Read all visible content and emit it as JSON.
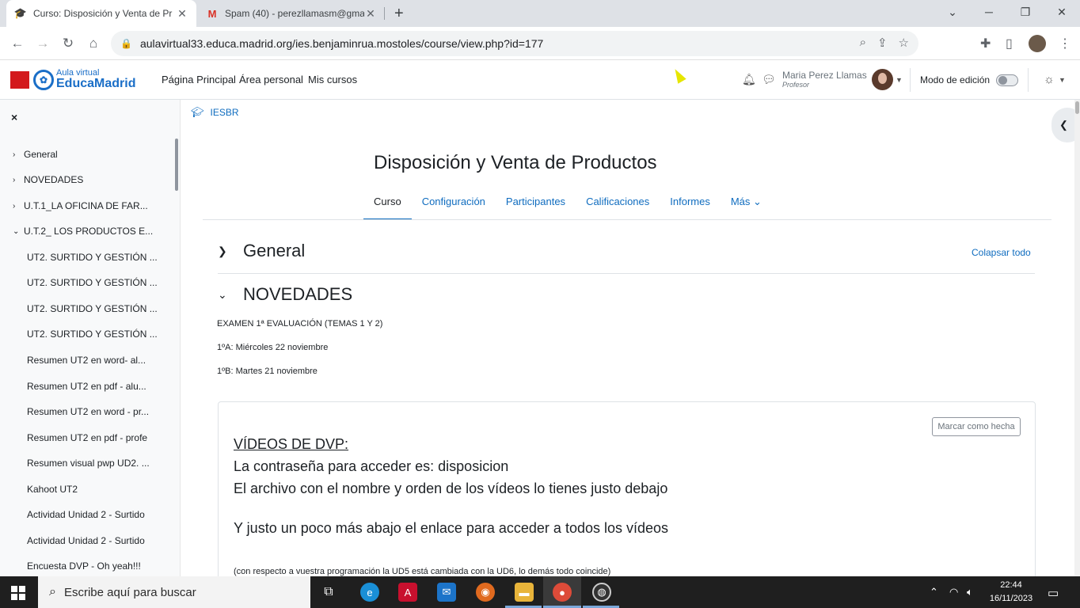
{
  "browser": {
    "tabs": [
      {
        "title": "Curso: Disposición y Venta de Pr",
        "close": "✕"
      },
      {
        "title": "Spam (40) - perezllamasm@gmail",
        "close": "✕"
      }
    ],
    "new_tab": "+",
    "url": "aulavirtual33.educa.madrid.org/ies.benjaminrua.mostoles/course/view.php?id=177"
  },
  "header": {
    "logo_top": "Aula virtual",
    "logo_bottom": "EducaMadrid",
    "nav": [
      "Página Principal",
      "Área personal",
      "Mis cursos"
    ],
    "user_name": "Maria Perez Llamas",
    "user_role": "Profesor",
    "edit_mode_label": "Modo de edición"
  },
  "drawer": {
    "close": "×",
    "items": [
      {
        "label": "General",
        "caret": "›"
      },
      {
        "label": "NOVEDADES",
        "caret": "›"
      },
      {
        "label": "U.T.1_LA OFICINA DE FAR...",
        "caret": "›"
      },
      {
        "label": "U.T.2_ LOS PRODUCTOS E...",
        "caret": "⌄"
      },
      {
        "label": "UT2. SURTIDO Y GESTIÓN ..."
      },
      {
        "label": "UT2. SURTIDO Y GESTIÓN ..."
      },
      {
        "label": "UT2. SURTIDO Y GESTIÓN ..."
      },
      {
        "label": "UT2. SURTIDO Y GESTIÓN ..."
      },
      {
        "label": "Resumen UT2 en word- al..."
      },
      {
        "label": "Resumen UT2 en pdf - alu..."
      },
      {
        "label": "Resumen UT2 en word - pr..."
      },
      {
        "label": "Resumen UT2 en pdf - profe"
      },
      {
        "label": "Resumen visual pwp UD2. ..."
      },
      {
        "label": "Kahoot UT2"
      },
      {
        "label": "Actividad Unidad 2 - Surtido"
      },
      {
        "label": "Actividad Unidad 2 - Surtido"
      },
      {
        "label": "Encuesta DVP - Oh yeah!!!"
      }
    ]
  },
  "main": {
    "breadcrumb": "IESBR",
    "course_title": "Disposición y Venta de Productos",
    "tabs": [
      "Curso",
      "Configuración",
      "Participantes",
      "Calificaciones",
      "Informes",
      "Más ⌄"
    ],
    "sections": {
      "general": "General",
      "novedades": "NOVEDADES",
      "collapse_all": "Colapsar todo"
    },
    "exam": {
      "title": "EXAMEN 1ª EVALUACIÓN (TEMAS 1 Y 2)",
      "a": "1ºA: Miércoles 22 noviembre",
      "b": "1ºB: Martes 21 noviembre"
    },
    "card": {
      "mark_done": "Marcar como hecha",
      "heading": "VÍDEOS DE DVP:",
      "line1": "La contraseña para acceder es: disposicion",
      "line2": "El archivo con el nombre y orden de los vídeos lo tienes justo debajo",
      "line3": "Y justo un poco más abajo el enlace para acceder a todos los vídeos",
      "note": "(con respecto a vuestra programación la UD5 está cambiada con la UD6, lo demás todo coincide)"
    }
  },
  "taskbar": {
    "search_placeholder": "Escribe aquí para buscar",
    "time": "22:44",
    "date": "16/11/2023"
  }
}
